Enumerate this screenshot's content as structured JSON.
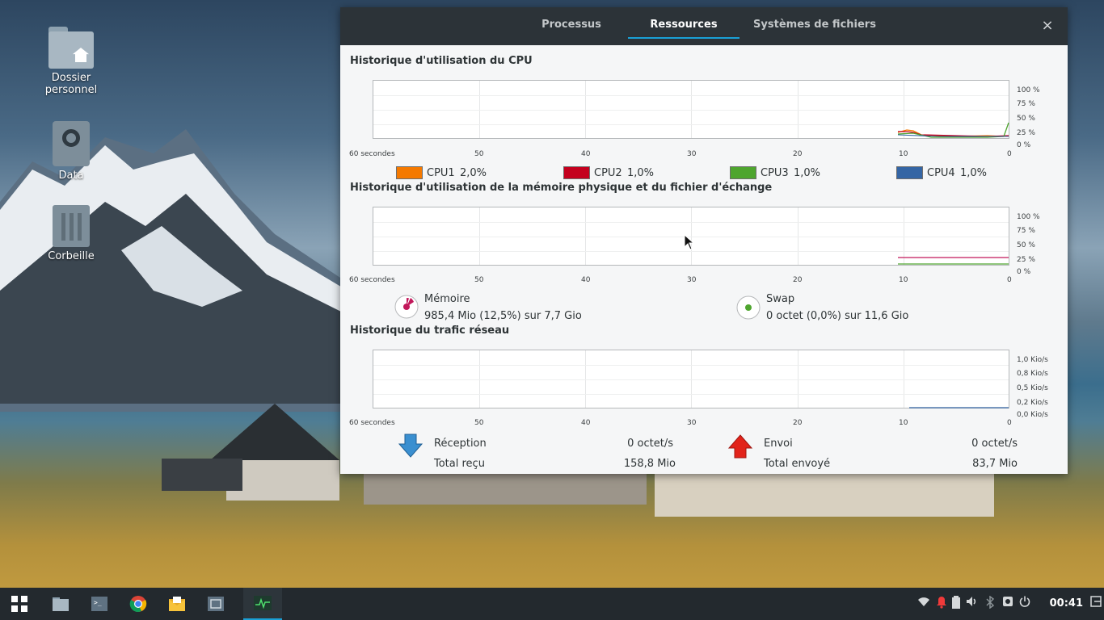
{
  "desktop": {
    "icons": [
      {
        "label_line1": "Dossier",
        "label_line2": "personnel",
        "icon": "home-folder-icon"
      },
      {
        "label_line1": "Data",
        "icon": "drive-icon"
      },
      {
        "label_line1": "Corbeille",
        "icon": "trash-icon"
      }
    ]
  },
  "window": {
    "tabs": [
      {
        "label": "Processus",
        "active": false
      },
      {
        "label": "Ressources",
        "active": true
      },
      {
        "label": "Systèmes de fichiers",
        "active": false
      }
    ],
    "close_label": "×"
  },
  "cpu": {
    "title": "Historique d'utilisation du CPU",
    "xlabels": [
      "60 secondes",
      "50",
      "40",
      "30",
      "20",
      "10",
      "0"
    ],
    "ylabels": [
      "100 %",
      "75 %",
      "50 %",
      "25 %",
      "0 %"
    ],
    "legend": [
      {
        "name": "CPU1",
        "value": "2,0%",
        "color": "#f57900"
      },
      {
        "name": "CPU2",
        "value": "1,0%",
        "color": "#c4001e"
      },
      {
        "name": "CPU3",
        "value": "1,0%",
        "color": "#4ea52e"
      },
      {
        "name": "CPU4",
        "value": "1,0%",
        "color": "#3465a4"
      }
    ]
  },
  "memory": {
    "title": "Historique d'utilisation de la mémoire physique et du fichier d'échange",
    "xlabels": [
      "60 secondes",
      "50",
      "40",
      "30",
      "20",
      "10",
      "0"
    ],
    "ylabels": [
      "100 %",
      "75 %",
      "50 %",
      "25 %",
      "0 %"
    ],
    "mem_label": "Mémoire",
    "mem_value": "985,4 Mio (12,5%) sur 7,7 Gio",
    "swap_label": "Swap",
    "swap_value": "0 octet (0,0%) sur 11,6 Gio",
    "mem_color": "#c2185b",
    "swap_color": "#4ea52e"
  },
  "network": {
    "title": "Historique du trafic réseau",
    "xlabels": [
      "60 secondes",
      "50",
      "40",
      "30",
      "20",
      "10",
      "0"
    ],
    "ylabels": [
      "1,0 Kio/s",
      "0,8 Kio/s",
      "0,5 Kio/s",
      "0,2 Kio/s",
      "0,0 Kio/s"
    ],
    "recv_label": "Réception",
    "recv_value": "0 octet/s",
    "total_recv_label": "Total reçu",
    "total_recv_value": "158,8 Mio",
    "send_label": "Envoi",
    "send_value": "0 octet/s",
    "total_sent_label": "Total envoyé",
    "total_sent_value": "83,7 Mio"
  },
  "taskbar": {
    "apps": [
      "apps-grid-icon",
      "files-icon",
      "terminal-icon",
      "chrome-icon",
      "mail-icon",
      "screenshot-icon",
      "system-monitor-icon"
    ],
    "tray": [
      "wifi-icon",
      "notification-bell-icon",
      "battery-icon",
      "volume-icon",
      "bluetooth-icon",
      "screen-icon",
      "power-icon"
    ],
    "clock": "00:41"
  }
}
